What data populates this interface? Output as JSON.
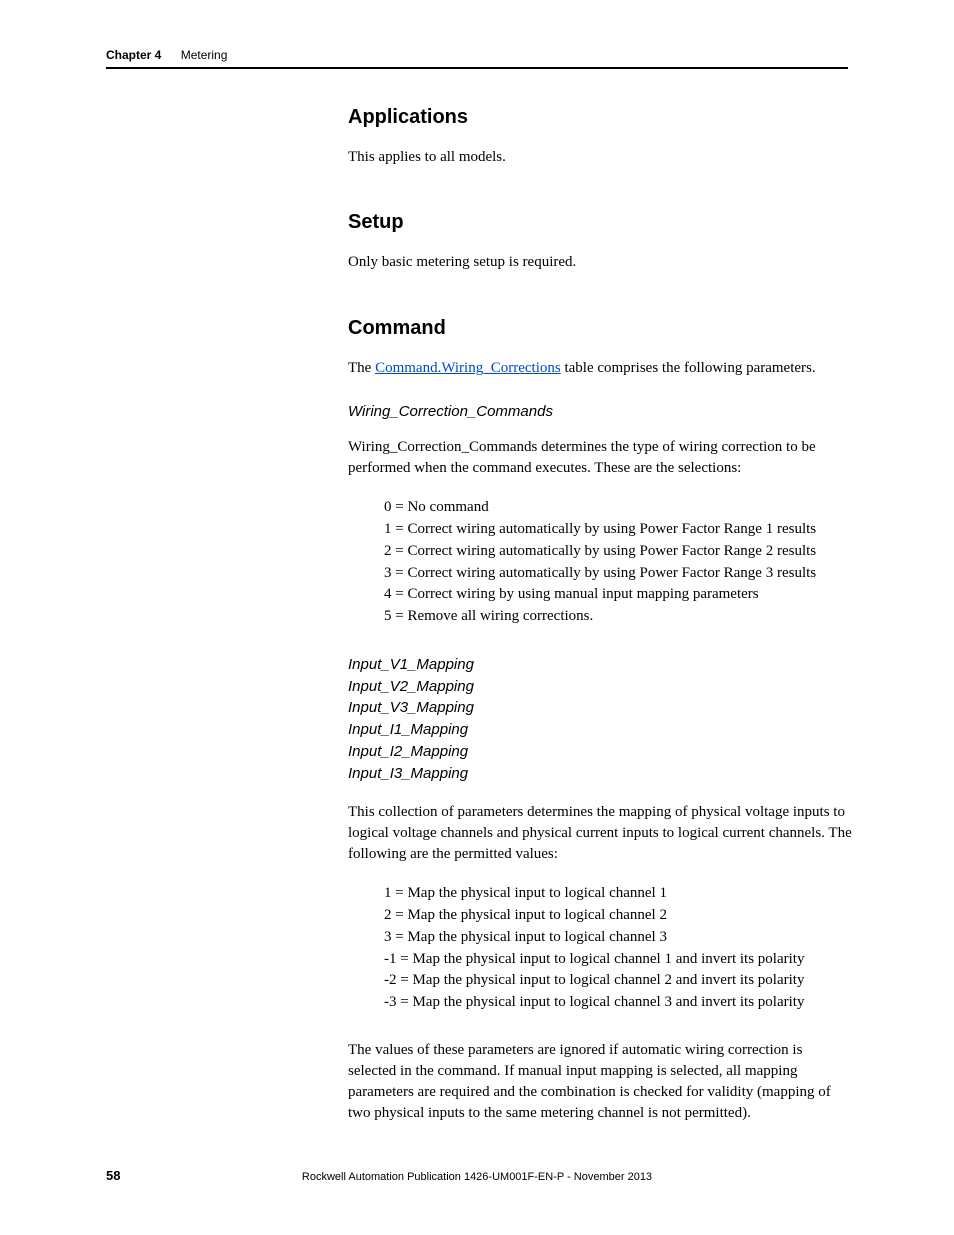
{
  "running_head": {
    "label": "Chapter 4",
    "title": "Metering"
  },
  "sections": {
    "applications": {
      "heading": "Applications",
      "body": "This applies to all models."
    },
    "setup": {
      "heading": "Setup",
      "body": "Only basic metering setup is required."
    },
    "command": {
      "heading": "Command",
      "lead_pre": "The ",
      "lead_link": "Command.Wiring_Corrections",
      "lead_post": " table comprises the following parameters.",
      "wcc": {
        "heading": "Wiring_Correction_Commands",
        "desc": "Wiring_Correction_Commands determines the type of wiring correction to be performed when the command executes. These are the selections:",
        "options": [
          "0 = No command",
          "1 = Correct wiring automatically by using Power Factor Range 1 results",
          "2 = Correct wiring automatically by using Power Factor Range 2 results",
          "3 = Correct wiring automatically by using Power Factor Range 3 results",
          "4 = Correct wiring by using manual input mapping parameters",
          "5 = Remove all wiring corrections."
        ]
      },
      "input_mappings": {
        "headings": [
          "Input_V1_Mapping",
          "Input_V2_Mapping",
          "Input_V3_Mapping",
          "Input_I1_Mapping",
          "Input_I2_Mapping",
          "Input_I3_Mapping"
        ],
        "desc": "This collection of parameters determines the mapping of physical voltage inputs to logical voltage channels and physical current inputs to logical current channels. The following are the permitted values:",
        "options": [
          "1 = Map the physical input to logical channel 1",
          "2 = Map the physical input to logical channel 2",
          "3 = Map the physical input to logical channel 3",
          "-1 = Map the physical input to logical channel 1 and invert its polarity",
          "-2 = Map the physical input to logical channel 2 and invert its polarity",
          "-3 = Map the physical input to logical channel 3 and invert its polarity"
        ],
        "note": "The values of these parameters are ignored if automatic wiring correction is selected in the command. If manual input mapping is selected, all mapping parameters are required and the combination is checked for validity (mapping of two physical inputs to the same metering channel is not permitted)."
      }
    }
  },
  "footer": {
    "page_number": "58",
    "publication": "Rockwell Automation Publication 1426-UM001F-EN-P - November 2013"
  }
}
